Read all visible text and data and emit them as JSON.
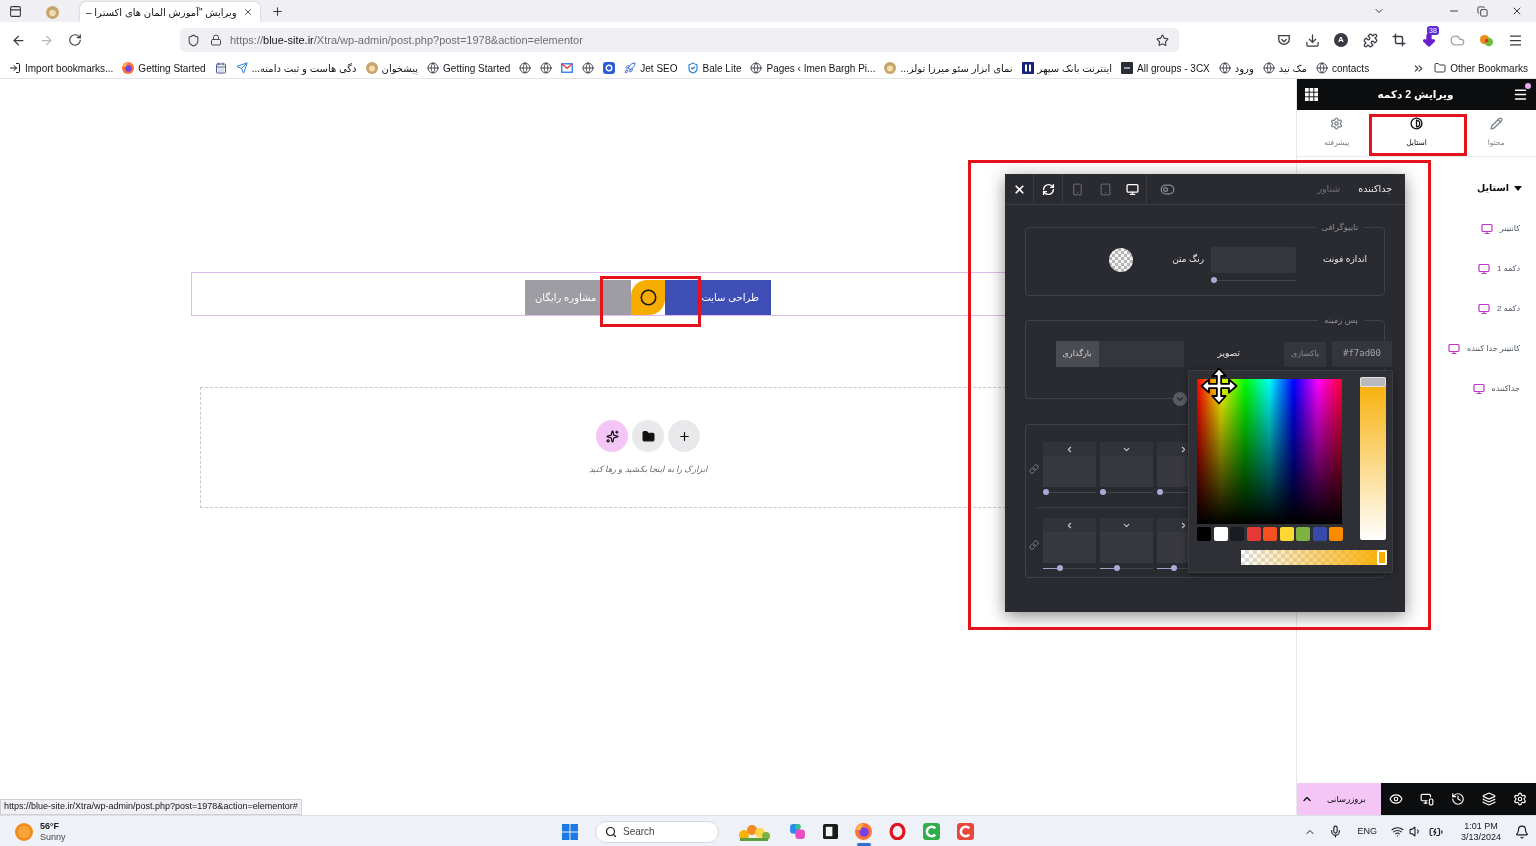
{
  "browser": {
    "tabs": [
      {
        "kind": "pinned",
        "selected": false
      },
      {
        "kind": "page",
        "title": "ویرایش \"آموزش المان های اکسترا –",
        "selected": true
      }
    ],
    "navigation": {
      "forward_disabled": true
    },
    "address": {
      "scheme": "https://",
      "domain": "blue-site.ir",
      "path": "/Xtra/wp-admin/post.php?post=1978&action=elementor"
    },
    "account_initial": "A",
    "extension_badge": "38",
    "bookmarks": [
      {
        "kind": "globe",
        "label": "contacts"
      },
      {
        "kind": "globe",
        "label": "مک نید"
      },
      {
        "kind": "globe",
        "label": "ورود"
      },
      {
        "kind": "dark-tile",
        "label": "All groups - 3CX"
      },
      {
        "kind": "bank",
        "label": "اینترنت بانک سپهر"
      },
      {
        "kind": "round-logo",
        "label": "...نمای ابزار سئو میرزا تولز"
      },
      {
        "kind": "globe",
        "label": "Pages ‹ Imen Bargh Pi..."
      },
      {
        "kind": "shield",
        "label": "Bale Lite"
      },
      {
        "kind": "rocket",
        "label": "Jet SEO"
      },
      {
        "kind": "tile"
      },
      {
        "kind": "globe"
      },
      {
        "kind": "mail"
      },
      {
        "kind": "globe"
      },
      {
        "kind": "globe"
      },
      {
        "kind": "globe",
        "label": "Getting Started"
      },
      {
        "kind": "round-logo",
        "label": "پیشخوان"
      },
      {
        "kind": "arrow",
        "label": "...دگی هاست و ثبت دامنه"
      },
      {
        "kind": "calendar"
      },
      {
        "kind": "browser",
        "label": "Getting Started"
      },
      {
        "kind": "import",
        "label": "Import bookmarks..."
      }
    ],
    "other_bookmarks": "Other Bookmarks"
  },
  "canvas": {
    "buttons": [
      {
        "kind": "primary",
        "label": "طراحی سایت"
      },
      {
        "kind": "secondary",
        "label": "مشاوره رایگان"
      }
    ],
    "drop_zone": {
      "actions": [
        {
          "kind": "ai"
        },
        {
          "kind": "template"
        },
        {
          "kind": "add"
        }
      ],
      "hint": "ابزارک را به اینجا بکشید و رها کنید"
    }
  },
  "style_popup": {
    "tabs": [
      {
        "label": "جداکننده",
        "selected": true
      },
      {
        "label": "شناور",
        "selected": false
      }
    ],
    "devices": [
      {
        "kind": "mobile",
        "selected": false
      },
      {
        "kind": "tablet",
        "selected": false
      },
      {
        "kind": "desktop",
        "selected": true
      }
    ],
    "typography": {
      "legend": "تایپوگرافی",
      "font_size_label": "اندازه فونت",
      "font_size_slider": {
        "level": 0
      },
      "text_color_label": "رنگ متن"
    },
    "background": {
      "legend": "پس زمینه",
      "color_value": "#f7ad00",
      "clear_button": "پاکسازی",
      "image_label": "تصویر",
      "upload_button": "بارگذاری"
    },
    "spacing_rows": [
      {
        "fields": [
          {
            "kind": "left",
            "level": 0
          },
          {
            "kind": "down",
            "level": 0
          },
          {
            "kind": "right",
            "level": 0
          }
        ]
      },
      {
        "fields": [
          {
            "kind": "left",
            "level": 0.3
          },
          {
            "kind": "down",
            "level": 0.3
          },
          {
            "kind": "right",
            "level": 0.3
          }
        ]
      }
    ]
  },
  "color_picker": {
    "value_slider": {
      "level": 1
    },
    "swatches": [
      {
        "color": "#000000"
      },
      {
        "color": "#ffffff"
      },
      {
        "color": "#1b1c21"
      },
      {
        "color": "#e53935"
      },
      {
        "color": "#f4511e"
      },
      {
        "color": "#fdd835"
      },
      {
        "color": "#7cb342"
      },
      {
        "color": "#3949ab"
      },
      {
        "color": "#fb8c00"
      }
    ],
    "alpha_slider": {
      "level": 1
    }
  },
  "panel": {
    "title": "ویرایش 2 دکمه",
    "tabs": [
      {
        "kind": "content",
        "label": "محتوا",
        "selected": false
      },
      {
        "kind": "style",
        "label": "استایل",
        "selected": true
      },
      {
        "kind": "advanced",
        "label": "پیشرفته",
        "selected": false
      }
    ],
    "section": {
      "label": "استایل",
      "expanded": true
    },
    "items": [
      "کانتینر",
      "دکمه 1",
      "دکمه 2",
      "کانتینر جدا کننده",
      "جداکننده"
    ],
    "update_button": "بروزرسانی",
    "tools": [
      {
        "kind": "preview"
      },
      {
        "kind": "responsive"
      },
      {
        "kind": "history"
      },
      {
        "kind": "navigator"
      },
      {
        "kind": "settings"
      }
    ]
  },
  "status_url": "https://blue-site.ir/Xtra/wp-admin/post.php?post=1978&action=elementor#",
  "taskbar": {
    "weather": {
      "temperature": "56°F",
      "condition": "Sunny"
    },
    "search_placeholder": "Search",
    "apps": [
      {
        "kind": "highlight",
        "active": false
      },
      {
        "kind": "copilot",
        "active": false
      },
      {
        "kind": "square",
        "active": false
      },
      {
        "kind": "browser",
        "active": true
      },
      {
        "kind": "ring",
        "active": false
      },
      {
        "kind": "green-arc",
        "active": false
      },
      {
        "kind": "red-arc",
        "active": false
      }
    ],
    "language": "ENG",
    "time": "1:01 PM",
    "date": "3/13/2024"
  }
}
